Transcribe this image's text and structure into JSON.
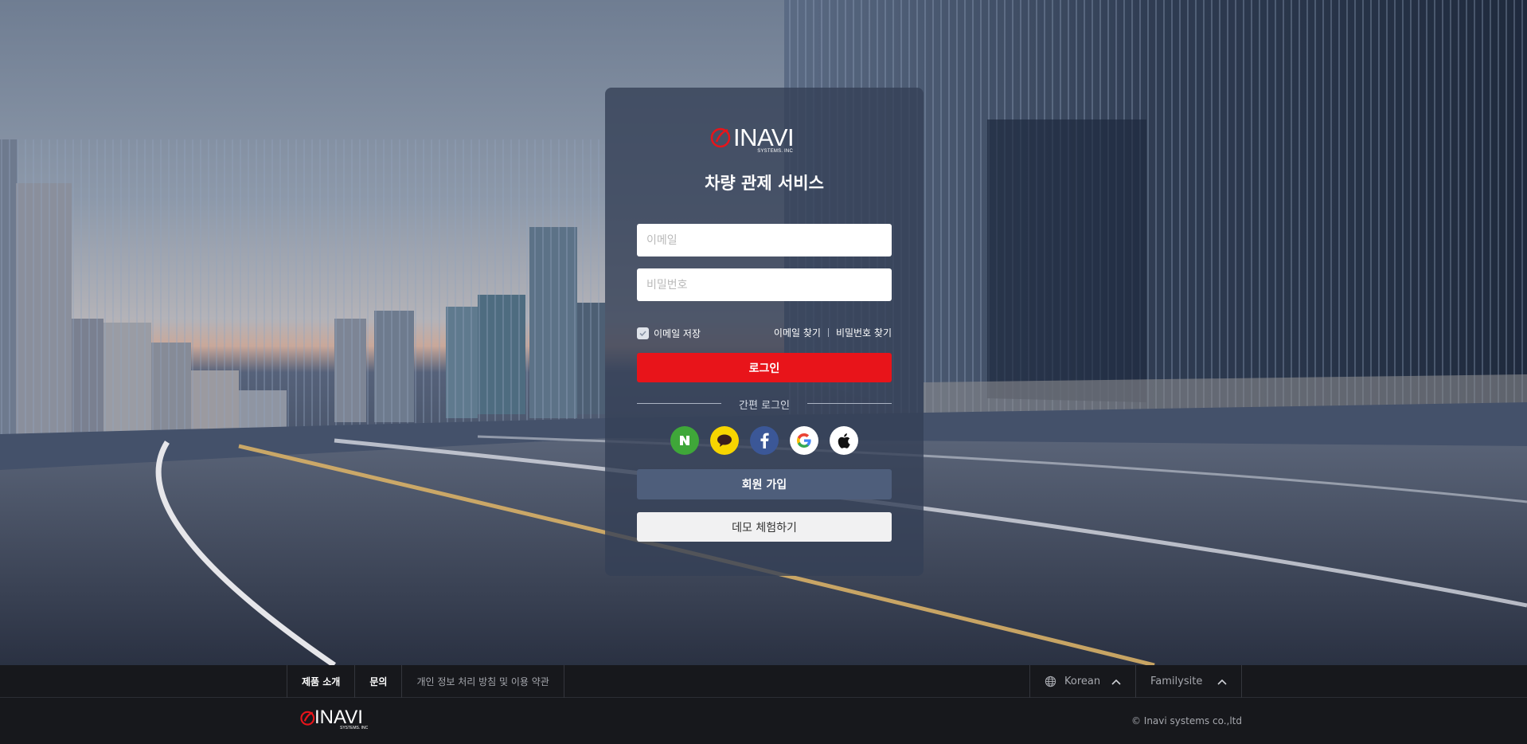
{
  "brand": {
    "logo_text": "INAVI",
    "logo_sub": "SYSTEMS. INC"
  },
  "login": {
    "service_title": "차량 관제 서비스",
    "email_placeholder": "이메일",
    "password_placeholder": "비밀번호",
    "save_email_label": "이메일 저장",
    "save_email_checked": true,
    "find_email": "이메일 찾기",
    "find_password": "비밀번호 찾기",
    "login_button": "로그인",
    "easy_login_label": "간편 로그인",
    "social_providers": [
      {
        "name": "Naver",
        "icon": "naver-icon",
        "color": "#3fa739"
      },
      {
        "name": "Kakao",
        "icon": "kakao-icon",
        "color": "#f7d500"
      },
      {
        "name": "Facebook",
        "icon": "facebook-icon",
        "color": "#3b5797"
      },
      {
        "name": "Google",
        "icon": "google-icon",
        "color": "#ffffff"
      },
      {
        "name": "Apple",
        "icon": "apple-icon",
        "color": "#ffffff"
      }
    ],
    "signup_button": "회원 가입",
    "demo_button": "데모 체험하기"
  },
  "footer": {
    "nav": [
      "제품 소개",
      "문의",
      "개인 정보 처리 방침 및 이용 약관"
    ],
    "language": "Korean",
    "familysite": "Familysite",
    "copyright": "© Inavi systems co.,ltd"
  },
  "colors": {
    "accent": "#e8141a",
    "card": "#344056",
    "signup": "#4e5e7b",
    "footer": "#17181c"
  }
}
